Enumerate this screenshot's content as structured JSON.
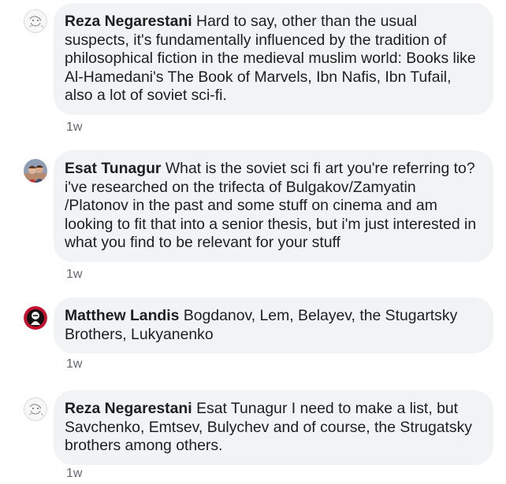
{
  "comments": [
    {
      "author": "Reza Negarestani",
      "mention": "",
      "text": " Hard to say, other than the usual suspects, it's fundamentally influenced by the tradition of philosophical fiction in the medieval muslim world: Books like Al-Hamedani's The Book of Marvels, Ibn Nafis, Ibn Tufail, also a lot of soviet sci-fi.",
      "time": "1w"
    },
    {
      "author": "Esat Tunagur",
      "mention": "",
      "text": " What is the soviet sci fi art you're referring to? i've researched on the trifecta of Bulgakov/Zamyatin /Platonov in the past and some stuff on cinema and am looking to fit that into a senior thesis, but i'm just interested in what you find to be relevant for your stuff",
      "time": "1w"
    },
    {
      "author": "Matthew Landis",
      "mention": "",
      "text": " Bogdanov, Lem, Belayev, the Stugartsky Brothers, Lukyanenko",
      "time": "1w"
    },
    {
      "author": "Reza Negarestani",
      "mention": "Esat Tunagur",
      "text": " I need to make a list, but Savchenko, Emtsev, Bulychev and of course, the Strugatsky brothers among others.",
      "time": "1w"
    }
  ]
}
